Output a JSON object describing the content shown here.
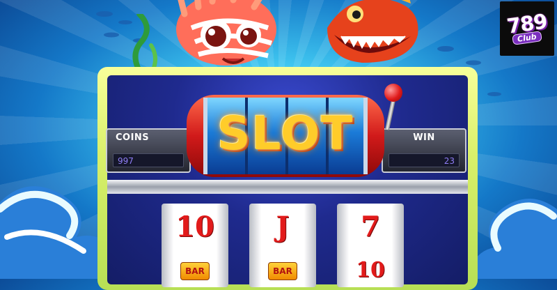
{
  "logo": {
    "number": "789",
    "club": "Club"
  },
  "title": "SLOT",
  "coins": {
    "label": "COINS",
    "value": "997"
  },
  "win": {
    "label": "WIN",
    "value": "23"
  },
  "reels": [
    {
      "top": "10",
      "bottom": "BAR"
    },
    {
      "top": "J",
      "bottom": "BAR"
    },
    {
      "top": "7",
      "bottom": "10"
    }
  ],
  "colors": {
    "frame": "#d9f06a",
    "panel_value": "#8f7df5",
    "title": "#ffcc2a",
    "symbol": "#e21b1b"
  }
}
